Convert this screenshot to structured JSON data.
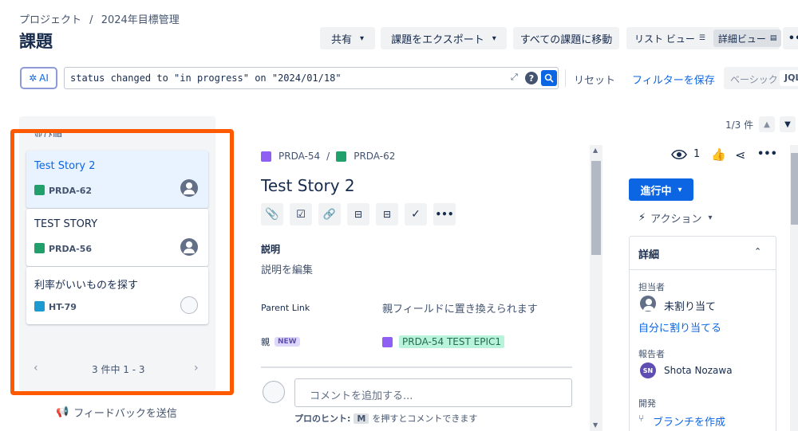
{
  "breadcrumb": {
    "project": "プロジェクト",
    "sep": "/",
    "page": "2024年目標管理"
  },
  "page_title": "課題",
  "toolbar": {
    "share": "共有",
    "export": "課題をエクスポート",
    "goto_all": "すべての課題に移動",
    "list_view": "リスト ビュー",
    "detail_view": "詳細ビュー",
    "more": "••"
  },
  "search": {
    "ai_label": "AI",
    "query": "status changed to \"in progress\" on \"2024/01/18\"",
    "reset": "リセット",
    "save_filter": "フィルターを保存",
    "basic": "ベーシック",
    "jql": "JQL"
  },
  "pager": {
    "label": "1/3 件"
  },
  "list": {
    "header": "並び順",
    "cards": [
      {
        "title": "Test Story 2",
        "key": "PRDA-62",
        "type_color": "#22a06b"
      },
      {
        "title": "TEST STORY",
        "key": "PRDA-56",
        "type_color": "#22a06b"
      },
      {
        "title": "利率がいいものを探す",
        "key": "HT-79",
        "type_color": "#1d9bd1"
      }
    ],
    "pagination": "3 件中 1 - 3"
  },
  "feedback": "フィードバックを送信",
  "issue": {
    "parent_key": "PRDA-54",
    "sep": "/",
    "key": "PRDA-62",
    "title": "Test Story 2",
    "desc_label": "説明",
    "desc_placeholder": "説明を編集",
    "parent_link_label": "Parent Link",
    "parent_link_value": "親フィールドに置き換えられます",
    "parent_label": "親",
    "new_badge": "NEW",
    "parent_value": "PRDA-54 TEST EPIC1",
    "comment_placeholder": "コメントを追加する...",
    "tip_prefix": "プロのヒント:",
    "tip_key": "M",
    "tip_suffix": "を押すとコメントできます"
  },
  "side": {
    "watch_count": "1",
    "status": "進行中",
    "action": "アクション",
    "details": "詳細",
    "assignee_label": "担当者",
    "assignee_value": "未割り当て",
    "assign_self": "自分に割り当てる",
    "reporter_label": "報告者",
    "reporter_initials": "SN",
    "reporter_name": "Shota Nozawa",
    "dev_label": "開発",
    "create_branch": "ブランチを作成"
  },
  "colors": {
    "accent": "#0c66e4",
    "highlight": "#ff5a00",
    "story": "#22a06b",
    "epic": "#8f5ef2"
  }
}
